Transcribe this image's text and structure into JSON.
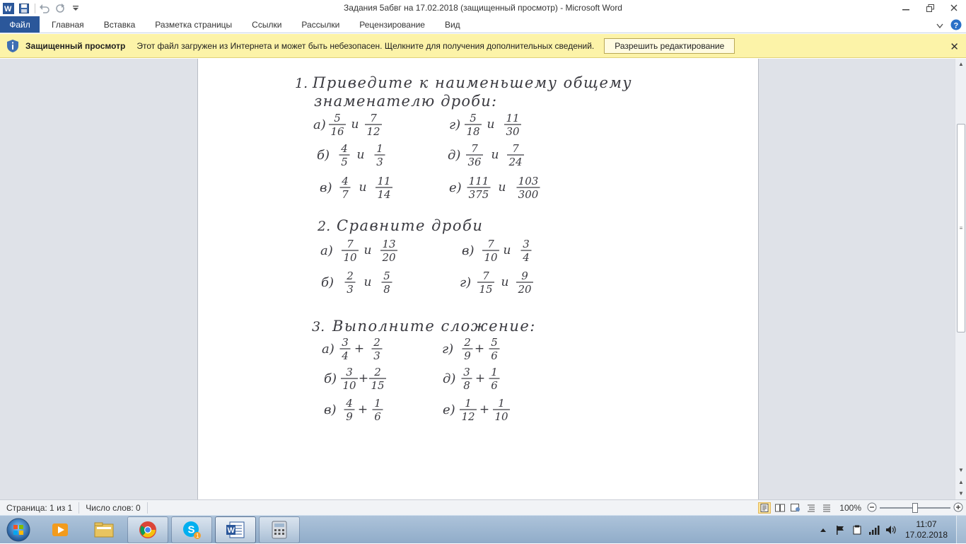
{
  "window": {
    "title": "Задания 5абвг на 17.02.2018 (защищенный просмотр)  -  Microsoft Word"
  },
  "qat": {
    "items": [
      "word-logo-icon",
      "save-icon",
      "undo-icon",
      "redo-icon",
      "customize-icon"
    ]
  },
  "ribbon": {
    "file_tab": "Файл",
    "tabs": [
      "Главная",
      "Вставка",
      "Разметка страницы",
      "Ссылки",
      "Рассылки",
      "Рецензирование",
      "Вид"
    ],
    "accent": "#2b579a"
  },
  "protected_view": {
    "title": "Защищенный просмотр",
    "message": "Этот файл загружен из Интернета и может быть небезопасен. Щелкните для получения дополнительных сведений.",
    "button": "Разрешить редактирование",
    "background": "#fcf3a8"
  },
  "document": {
    "task1": {
      "number": "1.",
      "line1": "Приведите  к  наименьшему  общему",
      "line2": "знаменателю  дроби:",
      "items": [
        {
          "label": "а)",
          "a": [
            "5",
            "16"
          ],
          "b": [
            "7",
            "12"
          ]
        },
        {
          "label": "г)",
          "a": [
            "5",
            "18"
          ],
          "b": [
            "11",
            "30"
          ]
        },
        {
          "label": "б)",
          "a": [
            "4",
            "5"
          ],
          "b": [
            "1",
            "3"
          ]
        },
        {
          "label": "д)",
          "a": [
            "7",
            "36"
          ],
          "b": [
            "7",
            "24"
          ]
        },
        {
          "label": "в)",
          "a": [
            "4",
            "7"
          ],
          "b": [
            "11",
            "14"
          ]
        },
        {
          "label": "е)",
          "a": [
            "111",
            "375"
          ],
          "b": [
            "103",
            "300"
          ]
        }
      ]
    },
    "task2": {
      "number": "2.",
      "title": "Сравните  дроби",
      "items": [
        {
          "label": "а)",
          "a": [
            "7",
            "10"
          ],
          "b": [
            "13",
            "20"
          ]
        },
        {
          "label": "в)",
          "a": [
            "7",
            "10"
          ],
          "b": [
            "3",
            "4"
          ]
        },
        {
          "label": "б)",
          "a": [
            "2",
            "3"
          ],
          "b": [
            "5",
            "8"
          ]
        },
        {
          "label": "г)",
          "a": [
            "7",
            "15"
          ],
          "b": [
            "9",
            "20"
          ]
        }
      ]
    },
    "task3": {
      "number": "3.",
      "title": "Выполните   сложение:",
      "items": [
        {
          "label": "а)",
          "a": [
            "3",
            "4"
          ],
          "b": [
            "2",
            "3"
          ]
        },
        {
          "label": "г)",
          "a": [
            "2",
            "9"
          ],
          "b": [
            "5",
            "6"
          ]
        },
        {
          "label": "б)",
          "a": [
            "3",
            "10"
          ],
          "b": [
            "2",
            "15"
          ]
        },
        {
          "label": "д)",
          "a": [
            "3",
            "8"
          ],
          "b": [
            "1",
            "6"
          ]
        },
        {
          "label": "в)",
          "a": [
            "4",
            "9"
          ],
          "b": [
            "1",
            "6"
          ]
        },
        {
          "label": "е)",
          "a": [
            "1",
            "12"
          ],
          "b": [
            "1",
            "10"
          ]
        }
      ]
    },
    "conjunction": "и",
    "plus": "+"
  },
  "status_bar": {
    "page": "Страница: 1 из 1",
    "words": "Число слов: 0",
    "zoom": "100%",
    "zoom_value_percent": 100
  },
  "taskbar": {
    "apps": [
      "start-orb-icon",
      "media-player-icon",
      "explorer-folder-icon",
      "chrome-icon",
      "skype-icon",
      "word-icon",
      "calculator-icon"
    ],
    "skype_badge": "1",
    "time": "11:07",
    "date": "17.02.2018"
  }
}
